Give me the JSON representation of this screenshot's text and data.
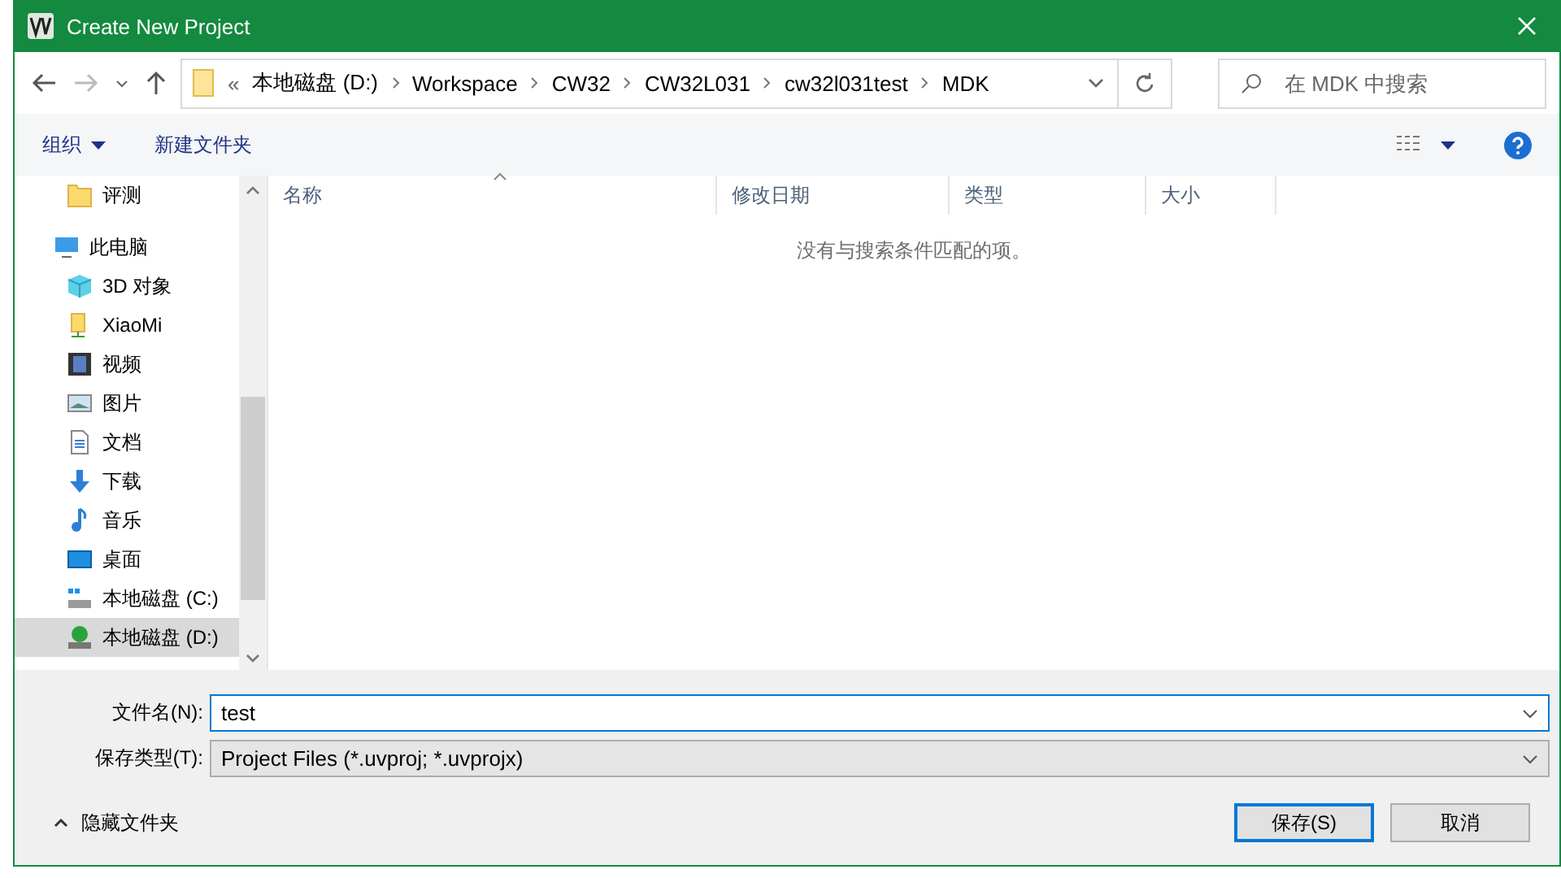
{
  "window": {
    "title": "Create New Project"
  },
  "address_bar": {
    "overflow": "«",
    "crumbs": [
      "本地磁盘 (D:)",
      "Workspace",
      "CW32",
      "CW32L031",
      "cw32l031test",
      "MDK"
    ]
  },
  "search": {
    "placeholder": "在 MDK 中搜索"
  },
  "toolbar": {
    "organize": "组织",
    "new_folder": "新建文件夹"
  },
  "sidebar": {
    "items": [
      {
        "label": "评测",
        "kind": "folder",
        "selected": false
      },
      {
        "label": "此电脑",
        "kind": "pc",
        "selected": false,
        "children": [
          {
            "label": "3D 对象",
            "kind": "cube",
            "selected": false
          },
          {
            "label": "XiaoMi",
            "kind": "netfolder",
            "selected": false
          },
          {
            "label": "视频",
            "kind": "video",
            "selected": false
          },
          {
            "label": "图片",
            "kind": "picture",
            "selected": false
          },
          {
            "label": "文档",
            "kind": "document",
            "selected": false
          },
          {
            "label": "下载",
            "kind": "download",
            "selected": false
          },
          {
            "label": "音乐",
            "kind": "music",
            "selected": false
          },
          {
            "label": "桌面",
            "kind": "desktop",
            "selected": false
          },
          {
            "label": "本地磁盘 (C:)",
            "kind": "drive",
            "selected": false
          },
          {
            "label": "本地磁盘 (D:)",
            "kind": "drive_d",
            "selected": true
          }
        ]
      }
    ]
  },
  "table": {
    "columns": [
      {
        "label": "名称",
        "sorted": true
      },
      {
        "label": "修改日期",
        "sorted": false
      },
      {
        "label": "类型",
        "sorted": false
      },
      {
        "label": "大小",
        "sorted": false
      }
    ],
    "empty_message": "没有与搜索条件匹配的项。"
  },
  "form": {
    "file_name": {
      "label": "文件名(N):",
      "value": "test"
    },
    "file_type": {
      "label": "保存类型(T):",
      "value": "Project Files (*.uvproj; *.uvprojx)"
    }
  },
  "hide_folders": "隐藏文件夹",
  "buttons": [
    {
      "label": "保存(S)",
      "default": true
    },
    {
      "label": "取消",
      "default": false
    }
  ]
}
